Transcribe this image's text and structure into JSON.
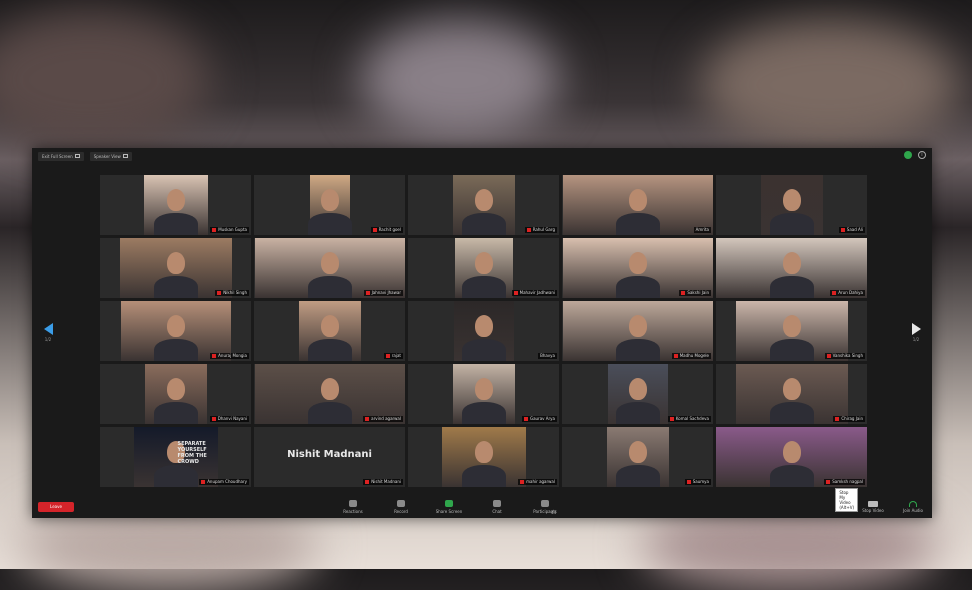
{
  "top_bar": {
    "exit_fullscreen_label": "Exit Full Screen",
    "speaker_view_label": "Speaker View"
  },
  "participants": [
    {
      "name": "Muskan Gupta",
      "muted": true,
      "tone": "#d9c3b3"
    },
    {
      "name": "Rachit goel",
      "muted": true,
      "tone": "#cfa984"
    },
    {
      "name": "Rahul Garg",
      "muted": true,
      "tone": "#7a6a58"
    },
    {
      "name": "Amrita",
      "muted": false,
      "tone": "#b59480"
    },
    {
      "name": "Saad Ali",
      "muted": true,
      "tone": "#3b3230"
    },
    {
      "name": "Nikhil Singh",
      "muted": true,
      "tone": "#9c7b62"
    },
    {
      "name": "Jahnavi Jhawar",
      "muted": true,
      "tone": "#c9b2a3"
    },
    {
      "name": "Mahavir Jadhwani",
      "muted": true,
      "tone": "#c8b9a8"
    },
    {
      "name": "Sakshi Jain",
      "muted": true,
      "tone": "#d8bfae"
    },
    {
      "name": "Arun Dahiya",
      "muted": true,
      "tone": "#d3c6bc",
      "active": true
    },
    {
      "name": "Anuraj Mongia",
      "muted": true,
      "tone": "#b58f78"
    },
    {
      "name": "rajat",
      "muted": true,
      "tone": "#c09c83"
    },
    {
      "name": "Bhavya",
      "muted": false,
      "tone": "#2c2828"
    },
    {
      "name": "Madhu Mogele",
      "muted": true,
      "tone": "#bda89a"
    },
    {
      "name": "Vanshika Singh",
      "muted": true,
      "tone": "#cbb6aa"
    },
    {
      "name": "Dhanvi Nayani",
      "muted": true,
      "tone": "#8a6c5c"
    },
    {
      "name": "arvind agarwal",
      "muted": true,
      "tone": "#5c4f48"
    },
    {
      "name": "Gaurav Arya",
      "muted": true,
      "tone": "#c3b3a5"
    },
    {
      "name": "Komal Sachdeva",
      "muted": true,
      "tone": "#4a4e5a"
    },
    {
      "name": "Chirag Jain",
      "muted": true,
      "tone": "#6b5a52"
    },
    {
      "name": "Anupam Choudhary",
      "muted": true,
      "tone": "#141a2a",
      "graphic_text": "SEPARATE YOURSELF FROM THE CROWD"
    },
    {
      "name": "Nishit Madnani",
      "muted": true,
      "tone": "#262626",
      "video_off": true
    },
    {
      "name": "mahir agarwal",
      "muted": true,
      "tone": "#a07a4a"
    },
    {
      "name": "Saumya",
      "muted": true,
      "tone": "#8a7a72"
    },
    {
      "name": "Samksh nagpal",
      "muted": true,
      "tone": "#8a5a8a"
    }
  ],
  "navigation": {
    "prev_page": "1/2",
    "next_page": "1/2"
  },
  "bottom_bar": {
    "leave_label": "Leave",
    "controls": [
      {
        "label": "Reactions",
        "icon": "smiley-icon"
      },
      {
        "label": "Record",
        "icon": "record-icon"
      },
      {
        "label": "Share Screen",
        "icon": "share-screen-icon",
        "accent": true
      },
      {
        "label": "Chat",
        "icon": "chat-icon"
      },
      {
        "label": "Participants",
        "icon": "participants-icon",
        "count": "44"
      }
    ],
    "stop_video_label": "Stop Video",
    "join_audio_label": "Join Audio",
    "tooltip": "Stop My Video (Alt+V)"
  }
}
